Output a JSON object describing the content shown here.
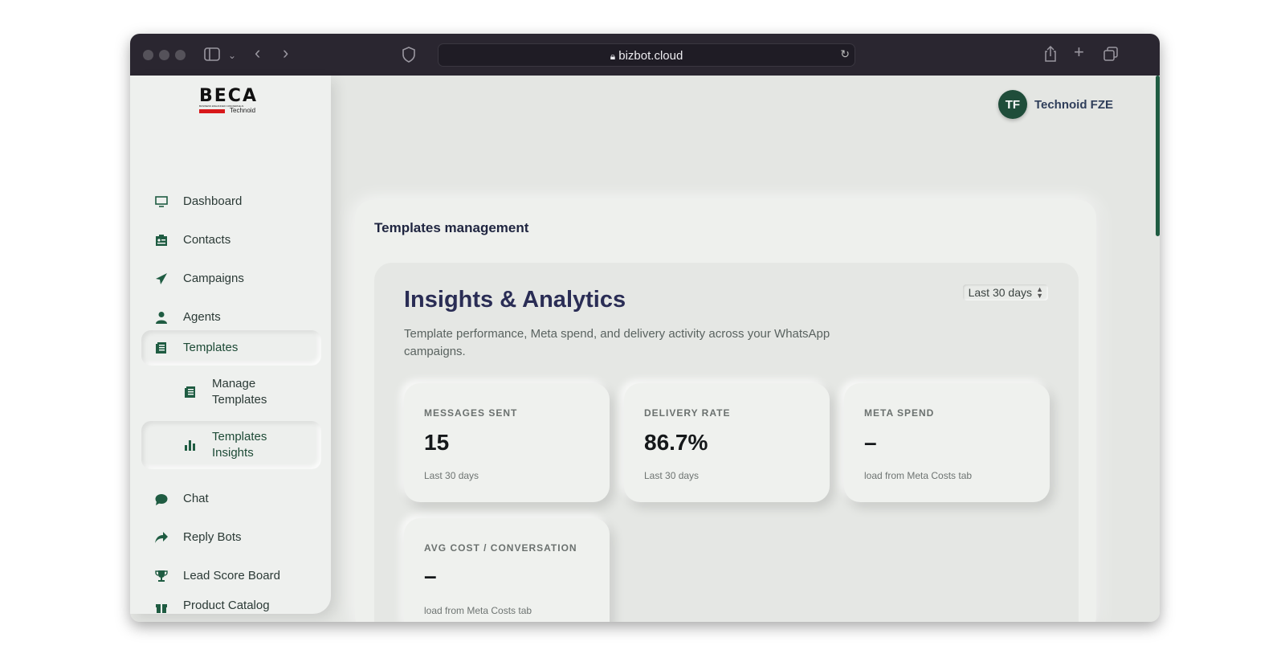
{
  "browser": {
    "url": "bizbot.cloud"
  },
  "logo": {
    "wordmark": "BECA",
    "tagline": "BUSINESS ENHANCED CONCIERGE AI",
    "brand": "Technoid"
  },
  "user": {
    "initials": "TF",
    "name": "Technoid FZE"
  },
  "sidebar": {
    "items": [
      {
        "label": "Dashboard",
        "icon": "monitor-icon"
      },
      {
        "label": "Contacts",
        "icon": "contact-card-icon"
      },
      {
        "label": "Campaigns",
        "icon": "paper-plane-icon"
      },
      {
        "label": "Agents",
        "icon": "user-icon"
      },
      {
        "label": "Templates",
        "icon": "document-icon"
      },
      {
        "label": "Manage Templates",
        "icon": "document-icon"
      },
      {
        "label": "Templates Insights",
        "icon": "bar-chart-icon"
      },
      {
        "label": "Chat",
        "icon": "chat-bubble-icon"
      },
      {
        "label": "Reply Bots",
        "icon": "reply-arrow-icon"
      },
      {
        "label": "Lead Score Board",
        "icon": "trophy-icon"
      },
      {
        "label": "Product Catalog",
        "icon": "gift-icon"
      }
    ]
  },
  "main": {
    "section_title": "Templates management",
    "heading": "Insights & Analytics",
    "description": "Template performance, Meta spend, and delivery activity across your WhatsApp campaigns.",
    "range_select": "Last 30 days",
    "cards": [
      {
        "label": "MESSAGES SENT",
        "value": "15",
        "sub": "Last 30 days"
      },
      {
        "label": "DELIVERY RATE",
        "value": "86.7%",
        "sub": "Last 30 days"
      },
      {
        "label": "META SPEND",
        "value": "–",
        "sub": "load from Meta Costs tab"
      },
      {
        "label": "AVG COST / CONVERSATION",
        "value": "–",
        "sub": "load from Meta Costs tab"
      }
    ]
  },
  "colors": {
    "accent": "#1f5c42",
    "heading": "#2a2d55",
    "background": "#e4e6e3"
  }
}
